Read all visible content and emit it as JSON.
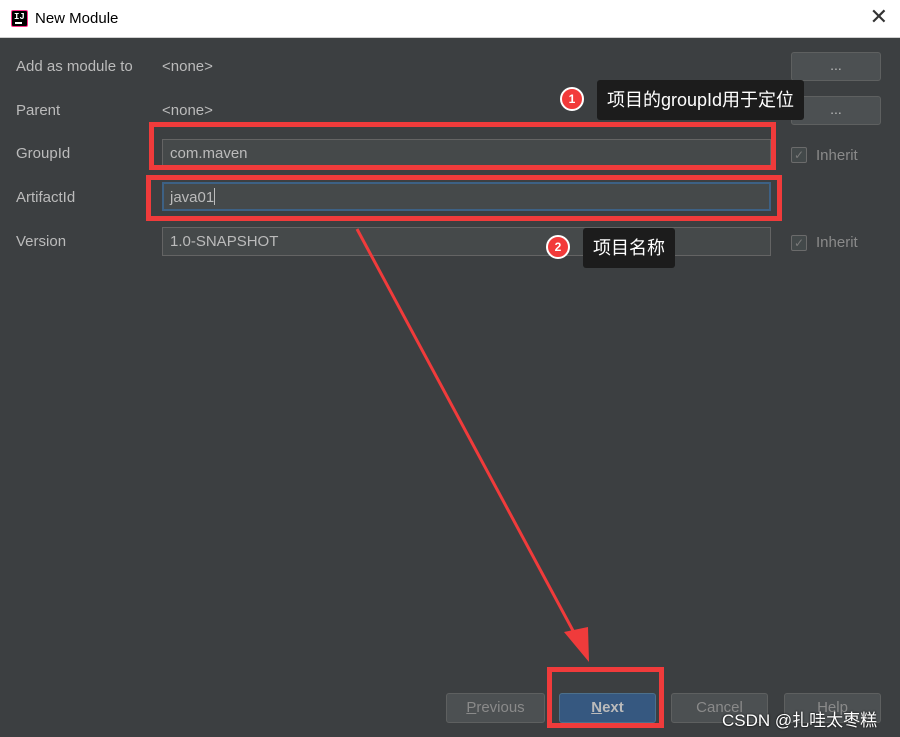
{
  "window": {
    "title": "New Module",
    "close_glyph": "✕",
    "app_icon": "intellij-idea-icon",
    "app_icon_text": "IJ"
  },
  "form": {
    "add_as_module_label": "Add as module to",
    "add_as_module_value": "<none>",
    "parent_label": "Parent",
    "parent_value": "<none>",
    "browse_label": "...",
    "groupid_label": "GroupId",
    "groupid_value": "com.maven",
    "groupid_inherit_label": "Inherit",
    "artifactid_label": "ArtifactId",
    "artifactid_value": "java01",
    "version_label": "Version",
    "version_value": "1.0-SNAPSHOT",
    "version_inherit_label": "Inherit",
    "check_glyph": "✓"
  },
  "buttons": {
    "previous_mnemonic": "P",
    "previous_rest": "revious",
    "next_mnemonic": "N",
    "next_rest": "ext",
    "cancel_label": "Cancel",
    "help_label": "Help"
  },
  "annotations": {
    "callout1_number": "1",
    "callout1_text": "项目的groupId用于定位",
    "callout2_number": "2",
    "callout2_text": "项目名称",
    "highlight_color": "#f03b3b"
  },
  "watermark": "CSDN @扎哇太枣糕",
  "colors": {
    "background": "#3c3f41",
    "primary_button": "#365880",
    "input_bg": "#45494a"
  }
}
